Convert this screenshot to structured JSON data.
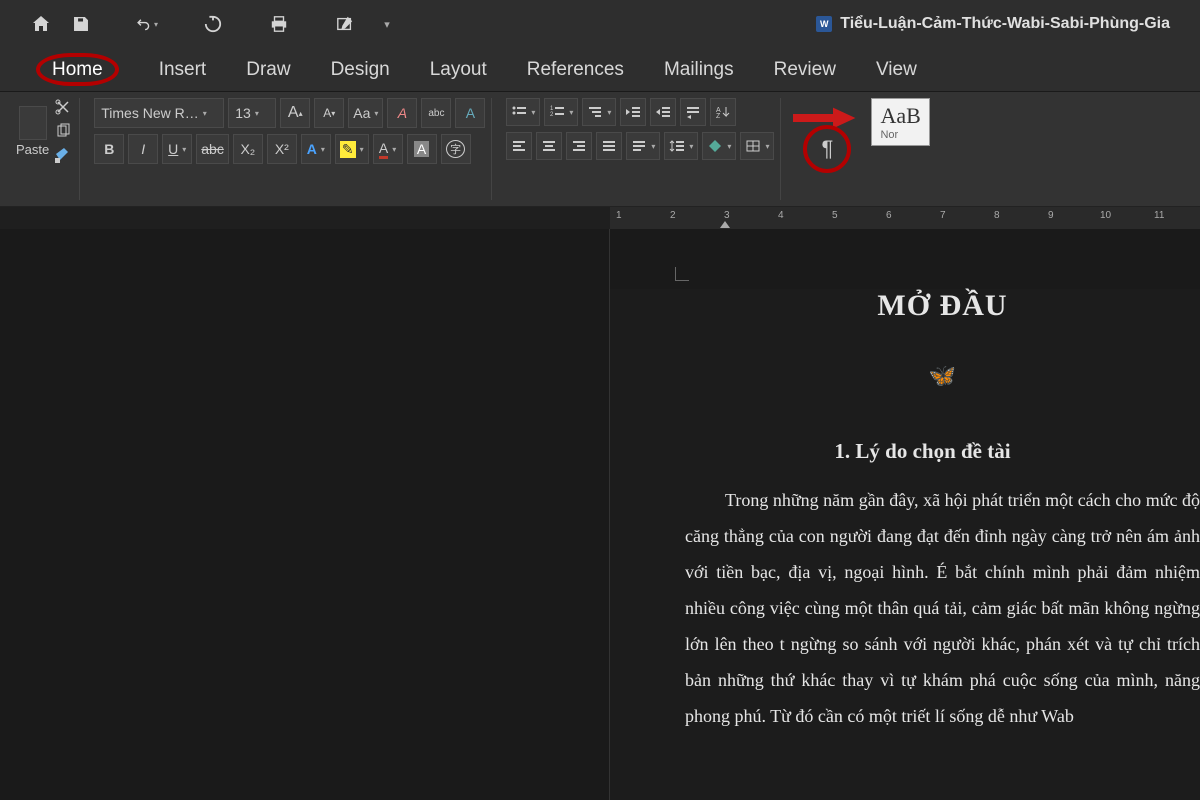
{
  "quick_access": {
    "doc_title": "Tiểu-Luận-Cảm-Thức-Wabi-Sabi-Phùng-Gia",
    "doc_badge": "W"
  },
  "tabs": {
    "home": "Home",
    "insert": "Insert",
    "draw": "Draw",
    "design": "Design",
    "layout": "Layout",
    "references": "References",
    "mailings": "Mailings",
    "review": "Review",
    "view": "View"
  },
  "ribbon": {
    "paste_label": "Paste",
    "font_name": "Times New R…",
    "font_size": "13",
    "bold": "B",
    "italic": "I",
    "underline": "U",
    "strike": "abc",
    "sub": "X₂",
    "sup": "X²",
    "grow": "A",
    "shrink": "A",
    "aa": "Aa",
    "clear": "A",
    "abc_check": "abc",
    "styles_sample": "AaB",
    "styles_label": "Nor",
    "pilcrow": "¶"
  },
  "ruler": {
    "marks": [
      "1",
      "2",
      "3",
      "4",
      "5",
      "6",
      "7",
      "8",
      "9",
      "10",
      "11"
    ]
  },
  "document": {
    "title": "MỞ ĐẦU",
    "section": "1.  Lý do chọn đề tài",
    "body": "Trong những năm gần đây, xã hội phát triển một cách cho mức độ căng thẳng của con người đang đạt đến đỉnh ngày càng trở nên ám ảnh với tiền bạc, địa vị, ngoại hình. É bắt chính mình phải đảm nhiệm nhiều công việc cùng một thân quá tải, cảm giác bất mãn không ngừng lớn lên theo t ngừng so sánh với người khác, phán xét và tự chỉ trích bản những thứ khác thay vì tự khám phá cuộc sống của mình, năng phong phú. Từ đó cần có một triết lí sống dễ như Wab"
  }
}
